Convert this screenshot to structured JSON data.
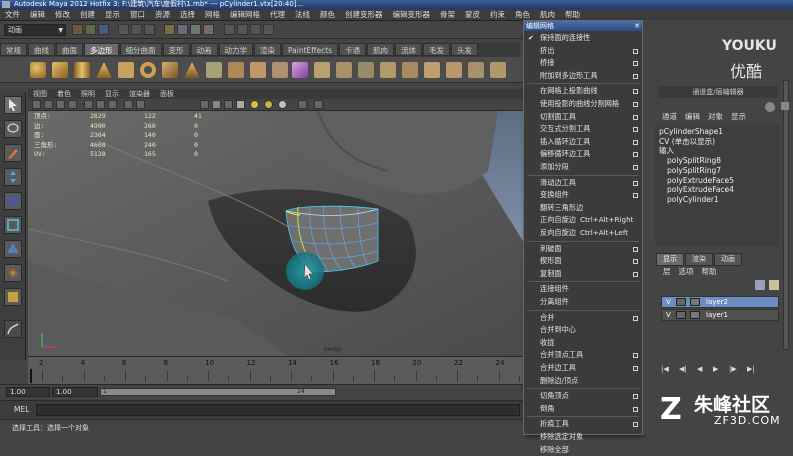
{
  "window": {
    "title": "Autodesk Maya 2012 Hotfix 3: F:\\建筑\\汽车\\度假村\\1.mb*  ---  pCylinder1.vtx[20:40]..."
  },
  "menubar": {
    "items": [
      "文件",
      "编辑",
      "修改",
      "创建",
      "显示",
      "窗口",
      "资源",
      "选择",
      "网格",
      "编辑网格",
      "代理",
      "法线",
      "颜色",
      "创建变形器",
      "编辑变形器",
      "骨架",
      "蒙皮",
      "约束",
      "角色",
      "肌肉",
      "帮助"
    ]
  },
  "statusline": {
    "mode": "动画",
    "field_y": "Y:",
    "field_z": "Z:"
  },
  "shelf": {
    "tabs": [
      "常规",
      "曲线",
      "曲面",
      "多边形",
      "细分曲面",
      "变形",
      "动画",
      "动力学",
      "渲染",
      "PaintEffects",
      "卡通",
      "肌肉",
      "流体",
      "毛发",
      "头发"
    ],
    "active_tab": "多边形"
  },
  "viewport": {
    "menu": [
      "视图",
      "着色",
      "照明",
      "显示",
      "渲染器",
      "面板"
    ],
    "hud": [
      {
        "label": "顶点:",
        "a": "2629",
        "b": "122",
        "c": "41"
      },
      {
        "label": "边:",
        "a": "4990",
        "b": "260",
        "c": "0"
      },
      {
        "label": "面:",
        "a": "2364",
        "b": "140",
        "c": "0"
      },
      {
        "label": "三角形:",
        "a": "4608",
        "b": "240",
        "c": "0"
      },
      {
        "label": "UV:",
        "a": "5128",
        "b": "165",
        "c": "0"
      }
    ],
    "camera": "persp"
  },
  "timeline": {
    "ticks": [
      "2",
      "4",
      "6",
      "8",
      "10",
      "12",
      "14",
      "16",
      "18",
      "20",
      "22",
      "24"
    ]
  },
  "range": {
    "start": "1.00",
    "current": "1.00",
    "frame_marker": "1",
    "end_frame": "24"
  },
  "mel": {
    "label": "MEL"
  },
  "help": {
    "text": "选择工具：选择一个对象"
  },
  "edit_mesh_menu": {
    "title": "编辑网格",
    "items": [
      {
        "label": "保持面的连接性",
        "check": true
      },
      {
        "label": "挤出",
        "opt": true
      },
      {
        "label": "桥接",
        "opt": true
      },
      {
        "label": "附加到多边形工具",
        "opt": true
      },
      {
        "sep": true
      },
      {
        "label": "在网格上投影曲线",
        "opt": true
      },
      {
        "label": "使用投影的曲线分割网格",
        "opt": true
      },
      {
        "label": "切割面工具",
        "opt": true
      },
      {
        "label": "交互式分割工具",
        "opt": true
      },
      {
        "label": "插入循环边工具",
        "opt": true
      },
      {
        "label": "偏移循环边工具",
        "opt": true
      },
      {
        "label": "添加分段",
        "opt": true
      },
      {
        "sep": true
      },
      {
        "label": "滑动边工具",
        "opt": true
      },
      {
        "label": "变换组件",
        "opt": true
      },
      {
        "label": "翻转三角形边",
        "opt": false
      },
      {
        "label": "正向自旋边",
        "shortcut": "Ctrl+Alt+Right"
      },
      {
        "label": "反向自旋边",
        "shortcut": "Ctrl+Alt+Left"
      },
      {
        "sep": true
      },
      {
        "label": "刺破面",
        "opt": true
      },
      {
        "label": "楔形面",
        "opt": true
      },
      {
        "label": "复制面",
        "opt": true
      },
      {
        "sep": true
      },
      {
        "label": "连接组件",
        "opt": false
      },
      {
        "label": "分离组件",
        "opt": false
      },
      {
        "sep": true
      },
      {
        "label": "合并",
        "opt": true
      },
      {
        "label": "合并到中心",
        "opt": false
      },
      {
        "label": "收拢",
        "opt": false
      },
      {
        "label": "合并顶点工具",
        "opt": true
      },
      {
        "label": "合并边工具",
        "opt": true
      },
      {
        "label": "删除边/顶点",
        "opt": false
      },
      {
        "sep": true
      },
      {
        "label": "切角顶点",
        "opt": true
      },
      {
        "label": "倒角",
        "opt": true
      },
      {
        "sep": true
      },
      {
        "label": "折痕工具",
        "opt": true
      },
      {
        "label": "移除选定对象",
        "opt": false
      },
      {
        "label": "移除全部",
        "opt": false
      }
    ]
  },
  "channel_box": {
    "title": "通道盒/层编辑器",
    "menu": [
      "通道",
      "编辑",
      "对象",
      "显示"
    ],
    "object": "pCylinderShape1",
    "cv_line": "CV (单击以显示)",
    "inputs_label": "输入",
    "inputs": [
      "polySplitRing8",
      "polySplitRing7",
      "polyExtrudeFace5",
      "polyExtrudeFace4",
      "polyCylinder1"
    ]
  },
  "layer_editor": {
    "tabs": [
      "显示",
      "渲染",
      "动画"
    ],
    "active_tab": "显示",
    "menu": [
      "层",
      "选项",
      "帮助"
    ],
    "layers": [
      {
        "v": "V",
        "name": "layer2",
        "selected": true
      },
      {
        "v": "V",
        "name": "layer1",
        "selected": false
      }
    ]
  },
  "watermarks": {
    "youku_en": "YOUKU",
    "youku_cn": "优酷",
    "site_cn": "朱峰社区",
    "site_en": "ZF3D.COM"
  },
  "colors": {
    "menu_bg": "#3b3b3b",
    "selection_blue": "#6c8dbf",
    "viewport_top": "#5d6d82",
    "cursor_ring": "#2aa6b3"
  }
}
